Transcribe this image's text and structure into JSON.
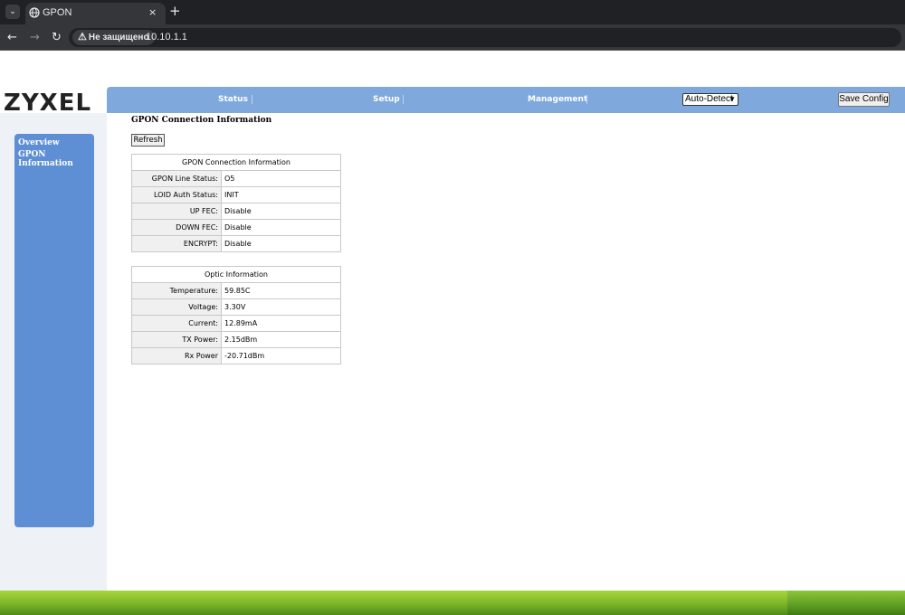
{
  "browser": {
    "tab_title": "GPON",
    "tab_close": "×",
    "new_tab": "+",
    "security_label": "Не защищено",
    "url": "10.10.1.1"
  },
  "logo_text": "ZYXEL",
  "topnav": {
    "items": [
      "Status",
      "Setup",
      "Management"
    ],
    "language_selected": "Auto-Detect",
    "save_config_label": "Save Config"
  },
  "sidebar": {
    "items": [
      "Overview",
      "GPON Information"
    ]
  },
  "page_title": "GPON Connection Information",
  "refresh_label": "Refresh",
  "gpon_table": {
    "title": "GPON Connection Information",
    "rows": [
      {
        "label": "GPON Line Status:",
        "value": "O5"
      },
      {
        "label": "LOID Auth Status:",
        "value": "INIT"
      },
      {
        "label": "UP FEC:",
        "value": "Disable"
      },
      {
        "label": "DOWN FEC:",
        "value": "Disable"
      },
      {
        "label": "ENCRYPT:",
        "value": "Disable"
      }
    ]
  },
  "optic_table": {
    "title": "Optic Information",
    "rows": [
      {
        "label": "Temperature:",
        "value": "59.85C"
      },
      {
        "label": "Voltage:",
        "value": "3.30V"
      },
      {
        "label": "Current:",
        "value": "12.89mA"
      },
      {
        "label": "TX Power:",
        "value": "2.15dBm"
      },
      {
        "label": "Rx Power",
        "value": "-20.71dBm"
      }
    ]
  },
  "colors": {
    "nav_bar": "#7fa8dc",
    "sidebar": "#5e8fd4",
    "footer_green": "#7bb52a"
  },
  "icons": [
    "chevron-down-icon",
    "globe-icon",
    "close-icon",
    "plus-icon",
    "back-arrow-icon",
    "forward-arrow-icon",
    "reload-icon",
    "warning-icon"
  ]
}
